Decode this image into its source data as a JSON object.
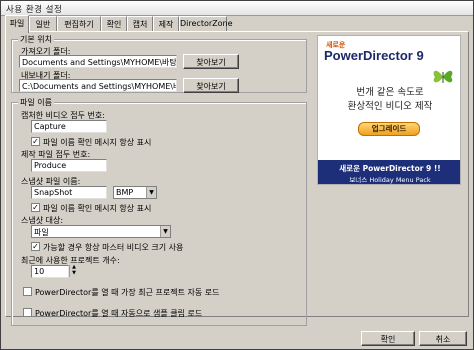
{
  "window": {
    "title": "사용 환경 설정"
  },
  "tabs": [
    "파일",
    "일반",
    "편집하기",
    "확인",
    "캡처",
    "제작",
    "DirectorZone"
  ],
  "location": {
    "group_title": "기본 위치",
    "import_label": "가져오기 폴더:",
    "import_value": "Documents and Settings\\MYHOME\\바탕 화면\\",
    "export_label": "내보내기 폴더:",
    "export_value": "C:\\Documents and Settings\\MYHOME\\바탕 화",
    "browse_label": "찾아보기"
  },
  "filename": {
    "group_title": "파일 이름",
    "capture_label": "캡처한 비디오 접두 번호:",
    "capture_value": "Capture",
    "capture_check": "파일 이름 확인 메시지 항상 표시",
    "produce_label": "제작 파일 접두 번호:",
    "produce_value": "Produce",
    "snapshot_label": "스냅샷 파일 이름:",
    "snapshot_value": "SnapShot",
    "snapshot_format": "BMP",
    "snapshot_check": "파일 이름 확인 메시지 항상 표시",
    "target_label": "스냅샷 대상:",
    "target_value": "파일",
    "master_check": "가능할 경우 항상 마스터 비디오 크기 사용",
    "recent_label": "최근에 사용한 프로젝트 개수:",
    "recent_value": "10",
    "autoload_check": "PowerDirector를 열 때 가장 최근 프로젝트 자동 로드",
    "sample_check": "PowerDirector를 열 때 자동으로 샘플 클립 로드"
  },
  "ad": {
    "tag": "새로운",
    "product": "PowerDirector 9",
    "line1": "번개 같은 속도로",
    "line2": "환상적인 비디오 제작",
    "upgrade": "업그레이드",
    "bottom1": "새로운 PowerDirector 9 !!",
    "bottom2": "보너스 Holiday Menu Pack"
  },
  "buttons": {
    "ok": "확인",
    "cancel": "취소"
  }
}
